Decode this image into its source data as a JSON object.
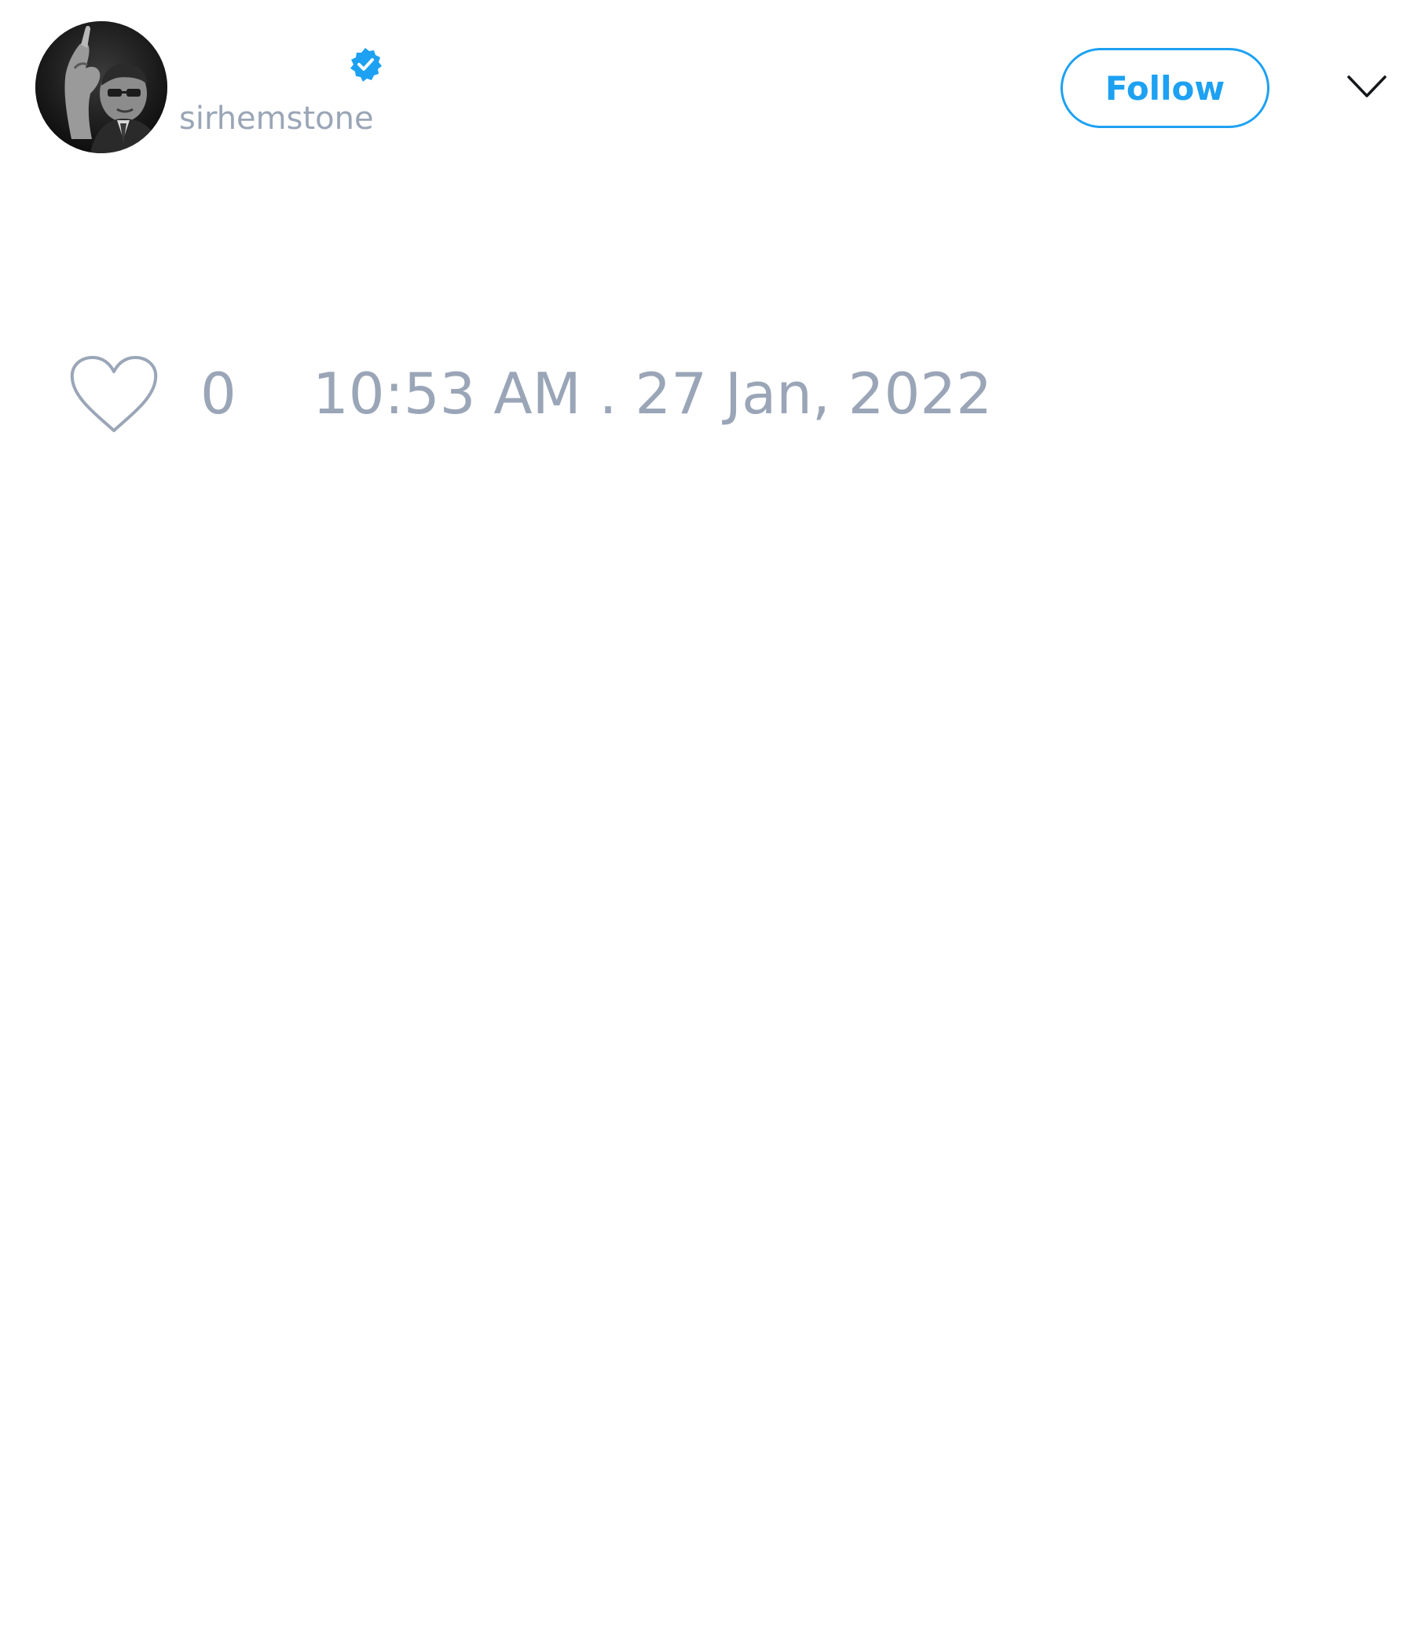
{
  "tweet": {
    "author": {
      "display_name": "",
      "handle": "sirhemstone",
      "verified": true,
      "avatar_icon": "profile-photo-icon"
    },
    "follow_label": "Follow",
    "menu_icon": "chevron-down-icon",
    "likes": {
      "icon": "heart-outline-icon",
      "count": "0"
    },
    "timestamp": "10:53 AM . 27 Jan, 2022"
  },
  "colors": {
    "accent": "#1da1f2",
    "muted_text": "#9aa6b7",
    "icon_stroke": "#9aa6b7",
    "background": "#ffffff"
  }
}
